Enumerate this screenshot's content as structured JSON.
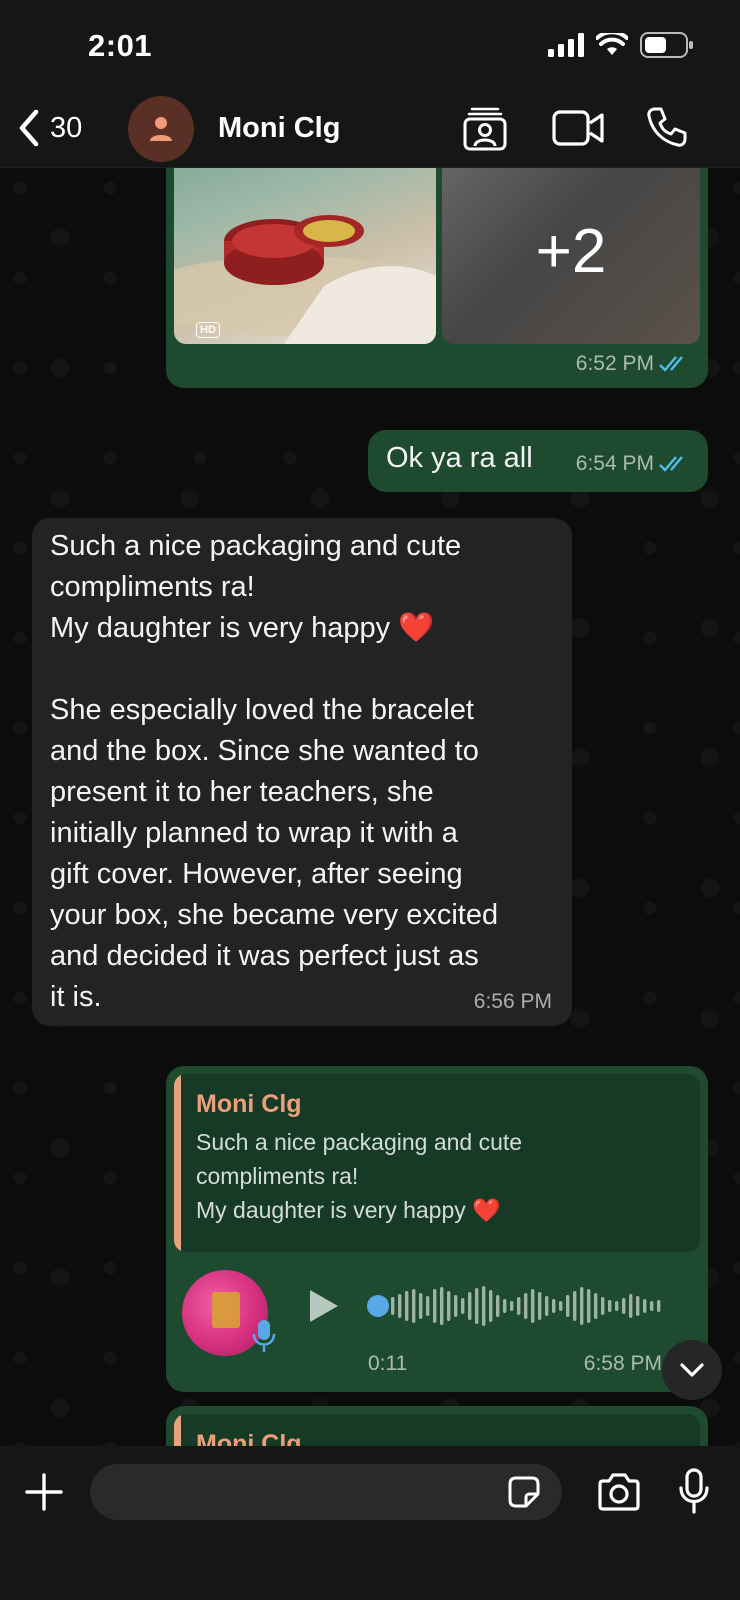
{
  "status_bar": {
    "time": "2:01",
    "battery_level": 0.55
  },
  "header": {
    "back_count": "30",
    "contact_name": "Moni Clg"
  },
  "messages": {
    "photos": {
      "more_count": "+2",
      "hd_badge": "HD",
      "time": "6:52 PM"
    },
    "ok": {
      "text": "Ok ya ra all",
      "time": "6:54 PM"
    },
    "incoming": {
      "text": "Such a nice packaging and cute\ncompliments ra!\nMy daughter is very happy ❤️\n\nShe especially loved the bracelet\nand the box. Since she wanted to\npresent it to her teachers, she\ninitially planned to wrap it with a\ngift cover. However, after seeing\nyour box, she became very excited\nand decided it was perfect just as\nit is.",
      "time": "6:56 PM"
    },
    "voice_reply": {
      "quote_name": "Moni Clg",
      "quote_text": "Such a nice packaging and cute\ncompliments ra!\nMy daughter is very happy ❤️",
      "duration": "0:11",
      "time": "6:58 PM",
      "progress": 0
    },
    "next_reply": {
      "quote_name": "Moni Clg"
    }
  },
  "colors": {
    "outgoing_bubble": "#1e4a30",
    "incoming_bubble": "#232323",
    "quote_accent": "#e8a27c",
    "read_ticks": "#53bdeb"
  },
  "icons": [
    "back-chevron-icon",
    "contact-avatar-icon",
    "contact-card-icon",
    "video-call-icon",
    "phone-icon",
    "double-check-icon",
    "play-icon",
    "mic-icon",
    "scroll-down-icon",
    "plus-icon",
    "sticker-icon",
    "camera-icon"
  ]
}
